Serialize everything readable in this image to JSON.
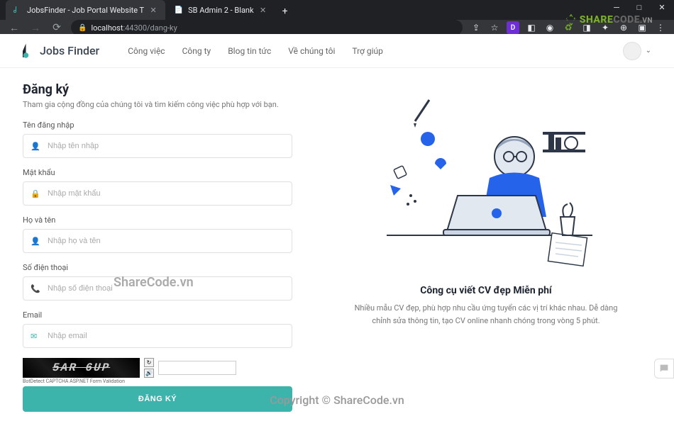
{
  "browser": {
    "tabs": [
      {
        "title": "JobsFinder - Job Portal Website T",
        "active": true
      },
      {
        "title": "SB Admin 2 - Blank",
        "active": false
      }
    ],
    "url_host": "localhost",
    "url_port": ":44300",
    "url_path": "/dang-ky"
  },
  "watermark": {
    "brand_green": "SHARE",
    "brand_gray": "CODE",
    "brand_vn": ".VN",
    "center": "ShareCode.vn",
    "bottom": "Copyright © ShareCode.vn"
  },
  "header": {
    "logo_text": "Jobs Finder",
    "nav": [
      "Công việc",
      "Công ty",
      "Blog tin tức",
      "Về chúng tôi",
      "Trợ giúp"
    ]
  },
  "form": {
    "title": "Đăng ký",
    "subtitle": "Tham gia cộng đồng của chúng tôi và tìm kiếm công việc phù hợp với bạn.",
    "fields": {
      "username": {
        "label": "Tên đăng nhập",
        "placeholder": "Nhập tên nhập"
      },
      "password": {
        "label": "Mật khẩu",
        "placeholder": "Nhập mật khẩu"
      },
      "fullname": {
        "label": "Họ và tên",
        "placeholder": "Nhập họ và tên"
      },
      "phone": {
        "label": "Số điện thoại",
        "placeholder": "Nhập số điện thoại"
      },
      "email": {
        "label": "Email",
        "placeholder": "Nhập email"
      }
    },
    "captcha_text": "5AR 6UP",
    "captcha_caption": "BotDetect CAPTCHA ASP.NET Form Validation",
    "submit": "ĐĂNG KÝ"
  },
  "promo": {
    "title": "Công cụ viết CV đẹp Miễn phí",
    "desc": "Nhiều mẫu CV đẹp, phù hợp nhu cầu ứng tuyển các vị trí khác nhau. Dễ dàng chỉnh sửa thông tin, tạo CV online nhanh chóng trong vòng 5 phút."
  },
  "colors": {
    "accent": "#3cb4ac",
    "dark": "#1e2530"
  }
}
